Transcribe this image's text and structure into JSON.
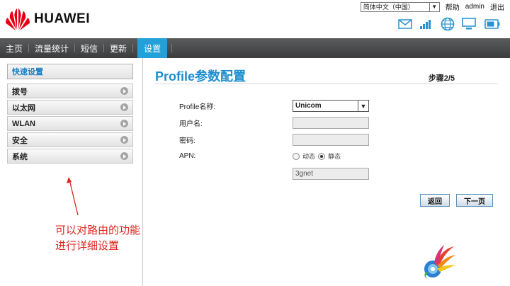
{
  "header": {
    "brand": "HUAWEI",
    "language": "简体中文（中国）",
    "help": "帮助",
    "user": "admin",
    "logout": "退出",
    "status_icons": [
      "mail-icon",
      "signal-icon",
      "globe-icon",
      "monitor-icon",
      "battery-icon"
    ]
  },
  "nav": {
    "items": [
      {
        "label": "主页"
      },
      {
        "label": "流量统计"
      },
      {
        "label": "短信"
      },
      {
        "label": "更新"
      },
      {
        "label": "设置"
      }
    ],
    "active_index": 4
  },
  "sidebar": {
    "quick_setup": "快速设置",
    "items": [
      {
        "label": "拨号"
      },
      {
        "label": "以太网"
      },
      {
        "label": "WLAN"
      },
      {
        "label": "安全"
      },
      {
        "label": "系统"
      }
    ]
  },
  "annotation": {
    "line1": "可以对路由的功能",
    "line2": "进行详细设置"
  },
  "main": {
    "title": "Profile参数配置",
    "step": "步骤2/5",
    "form": {
      "profile_label": "Profile名称:",
      "profile_value": "Unicom",
      "username_label": "用户名:",
      "username_value": "",
      "password_label": "密码:",
      "password_value": "",
      "apn_label": "APN:",
      "apn_dynamic": "动态",
      "apn_static": "静态",
      "apn_selected": "静态",
      "apn_value": "3gnet"
    },
    "back_button": "返回",
    "next_button": "下一页"
  },
  "colors": {
    "accent": "#22a0d9",
    "title": "#1d8fcf",
    "navbar": "#45474a",
    "annotation": "#e0231d"
  }
}
